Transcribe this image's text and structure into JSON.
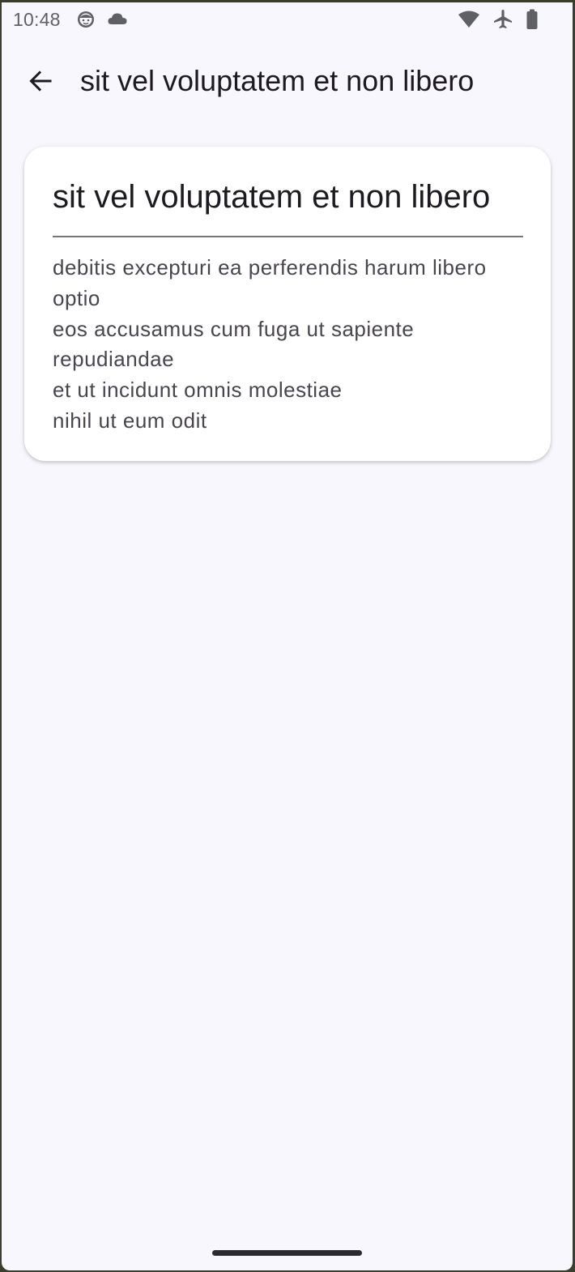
{
  "status_bar": {
    "time": "10:48",
    "left_icons": [
      "android-face-icon",
      "cloud-icon"
    ],
    "right_icons": [
      "wifi-icon",
      "airplane-icon",
      "battery-icon"
    ]
  },
  "app_bar": {
    "back_icon": "arrow-back-icon",
    "title": "sit vel voluptatem et non libero"
  },
  "card": {
    "title": "sit vel voluptatem et non libero",
    "body_lines": [
      "debitis excepturi ea perferendis harum libero",
      "optio",
      "eos accusamus cum fuga ut sapiente",
      "repudiandae",
      "et ut incidunt omnis molestiae",
      "nihil ut eum odit"
    ]
  },
  "colors": {
    "background": "#f8f7fd",
    "surface": "#ffffff",
    "on_surface": "#1d1b20",
    "on_surface_variant": "#49454f",
    "outline": "#76747c"
  }
}
